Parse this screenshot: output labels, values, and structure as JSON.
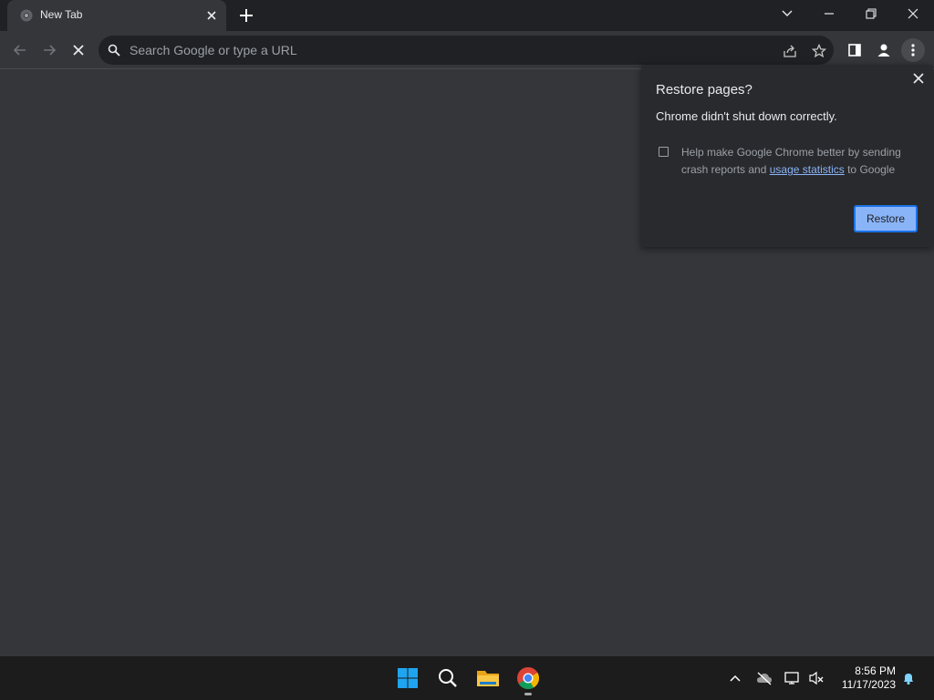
{
  "tab": {
    "title": "New Tab",
    "favicon": "chrome-icon"
  },
  "window_controls": [
    "tab-search",
    "minimize",
    "restore",
    "close"
  ],
  "toolbar": {
    "icons": [
      "back-arrow-icon",
      "forward-arrow-icon",
      "stop-loading-icon",
      "share-icon",
      "bookmark-star-icon",
      "side-panel-icon",
      "profile-icon",
      "more-menu-icon"
    ]
  },
  "omnibox": {
    "placeholder": "Search Google or type a URL",
    "value": ""
  },
  "restore_bubble": {
    "title": "Restore pages?",
    "message": "Chrome didn't shut down correctly.",
    "consent_prefix": "Help make Google Chrome better by sending crash reports and ",
    "consent_link": "usage statistics",
    "consent_suffix": " to Google",
    "checkbox_checked": false,
    "button": "Restore"
  },
  "taskbar": {
    "apps": [
      "windows-start-icon",
      "search-icon",
      "file-explorer-icon",
      "chrome-icon"
    ],
    "tray": [
      "show-hidden-icons-chevron",
      "onedrive-offline-icon",
      "network-icon",
      "volume-muted-icon"
    ],
    "time": "8:56 PM",
    "date": "11/17/2023"
  },
  "colors": {
    "tab_strip": "#202124",
    "toolbar": "#35363a",
    "omnibox": "#202124",
    "bubble": "#292a2d",
    "accent": "#8ab4f8",
    "taskbar": "#1c1c1c"
  }
}
